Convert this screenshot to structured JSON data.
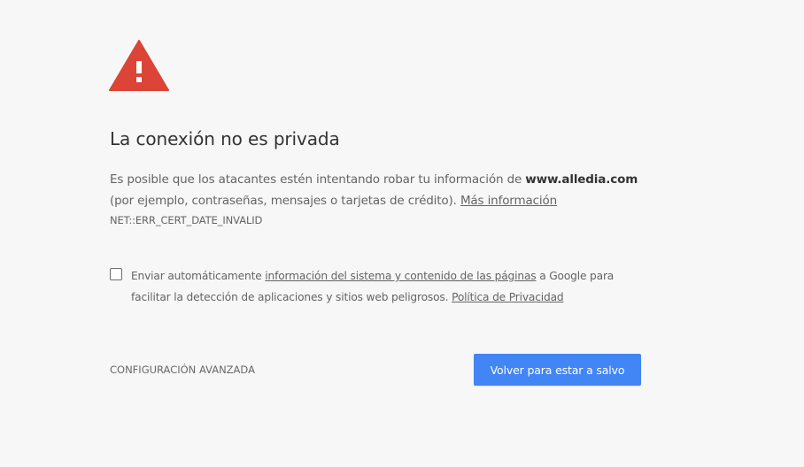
{
  "colors": {
    "background": "#f7f7f7",
    "warning_red": "#db4437",
    "primary_blue": "#4285f4",
    "heading_text": "#333333",
    "body_text": "#646464"
  },
  "icon": {
    "name": "warning-triangle-icon"
  },
  "heading": "La conexión no es privada",
  "explanation": {
    "prefix": "Es posible que los atacantes estén intentando robar tu información de ",
    "domain": "www.alledia.com",
    "suffix": " (por ejemplo, contraseñas, mensajes o tarjetas de crédito). ",
    "learn_more_link": "Más información"
  },
  "error_code": "NET::ERR_CERT_DATE_INVALID",
  "optin": {
    "checked": false,
    "text_before": "Enviar automáticamente ",
    "system_info_link": "información del sistema y contenido de las páginas",
    "text_middle": " a Google para facilitar la detección de aplicaciones y sitios web peligrosos. ",
    "privacy_link": "Política de Privacidad"
  },
  "buttons": {
    "advanced": "CONFIGURACIÓN AVANZADA",
    "back_to_safety": "Volver para estar a salvo"
  }
}
